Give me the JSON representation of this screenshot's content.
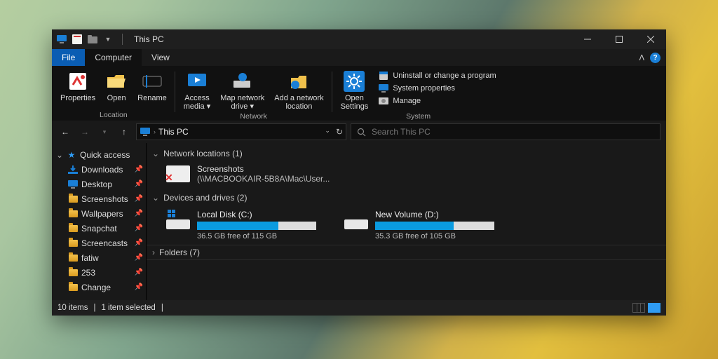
{
  "title": "This PC",
  "tabs": {
    "file": "File",
    "computer": "Computer",
    "view": "View"
  },
  "ribbon": {
    "location": {
      "group": "Location",
      "properties": "Properties",
      "open": "Open",
      "rename": "Rename"
    },
    "network": {
      "group": "Network",
      "access_media": "Access\nmedia ▾",
      "map_drive": "Map network\ndrive ▾",
      "add_location": "Add a network\nlocation"
    },
    "system": {
      "group": "System",
      "open_settings": "Open\nSettings",
      "uninstall": "Uninstall or change a program",
      "props": "System properties",
      "manage": "Manage"
    }
  },
  "breadcrumb": {
    "label": "This PC"
  },
  "search": {
    "placeholder": "Search This PC"
  },
  "sidebar": {
    "quick_access": "Quick access",
    "items": [
      {
        "label": "Downloads",
        "icon": "download"
      },
      {
        "label": "Desktop",
        "icon": "desktop"
      },
      {
        "label": "Screenshots",
        "icon": "folder"
      },
      {
        "label": "Wallpapers",
        "icon": "folder"
      },
      {
        "label": "Snapchat",
        "icon": "folder"
      },
      {
        "label": "Screencasts",
        "icon": "folder"
      },
      {
        "label": "fatiw",
        "icon": "folder"
      },
      {
        "label": "253",
        "icon": "folder"
      },
      {
        "label": "Change",
        "icon": "folder"
      }
    ]
  },
  "sections": {
    "netloc_head": "Network locations (1)",
    "netloc_name": "Screenshots",
    "netloc_path": "(\\\\MACBOOKAIR-5B8A\\Mac\\User...",
    "drives_head": "Devices and drives (2)",
    "folders_head": "Folders (7)"
  },
  "drives": [
    {
      "name": "Local Disk (C:)",
      "free": "36.5 GB free of 115 GB",
      "pct": 68
    },
    {
      "name": "New Volume (D:)",
      "free": "35.3 GB free of 105 GB",
      "pct": 66
    }
  ],
  "status": {
    "items": "10 items",
    "selected": "1 item selected"
  }
}
